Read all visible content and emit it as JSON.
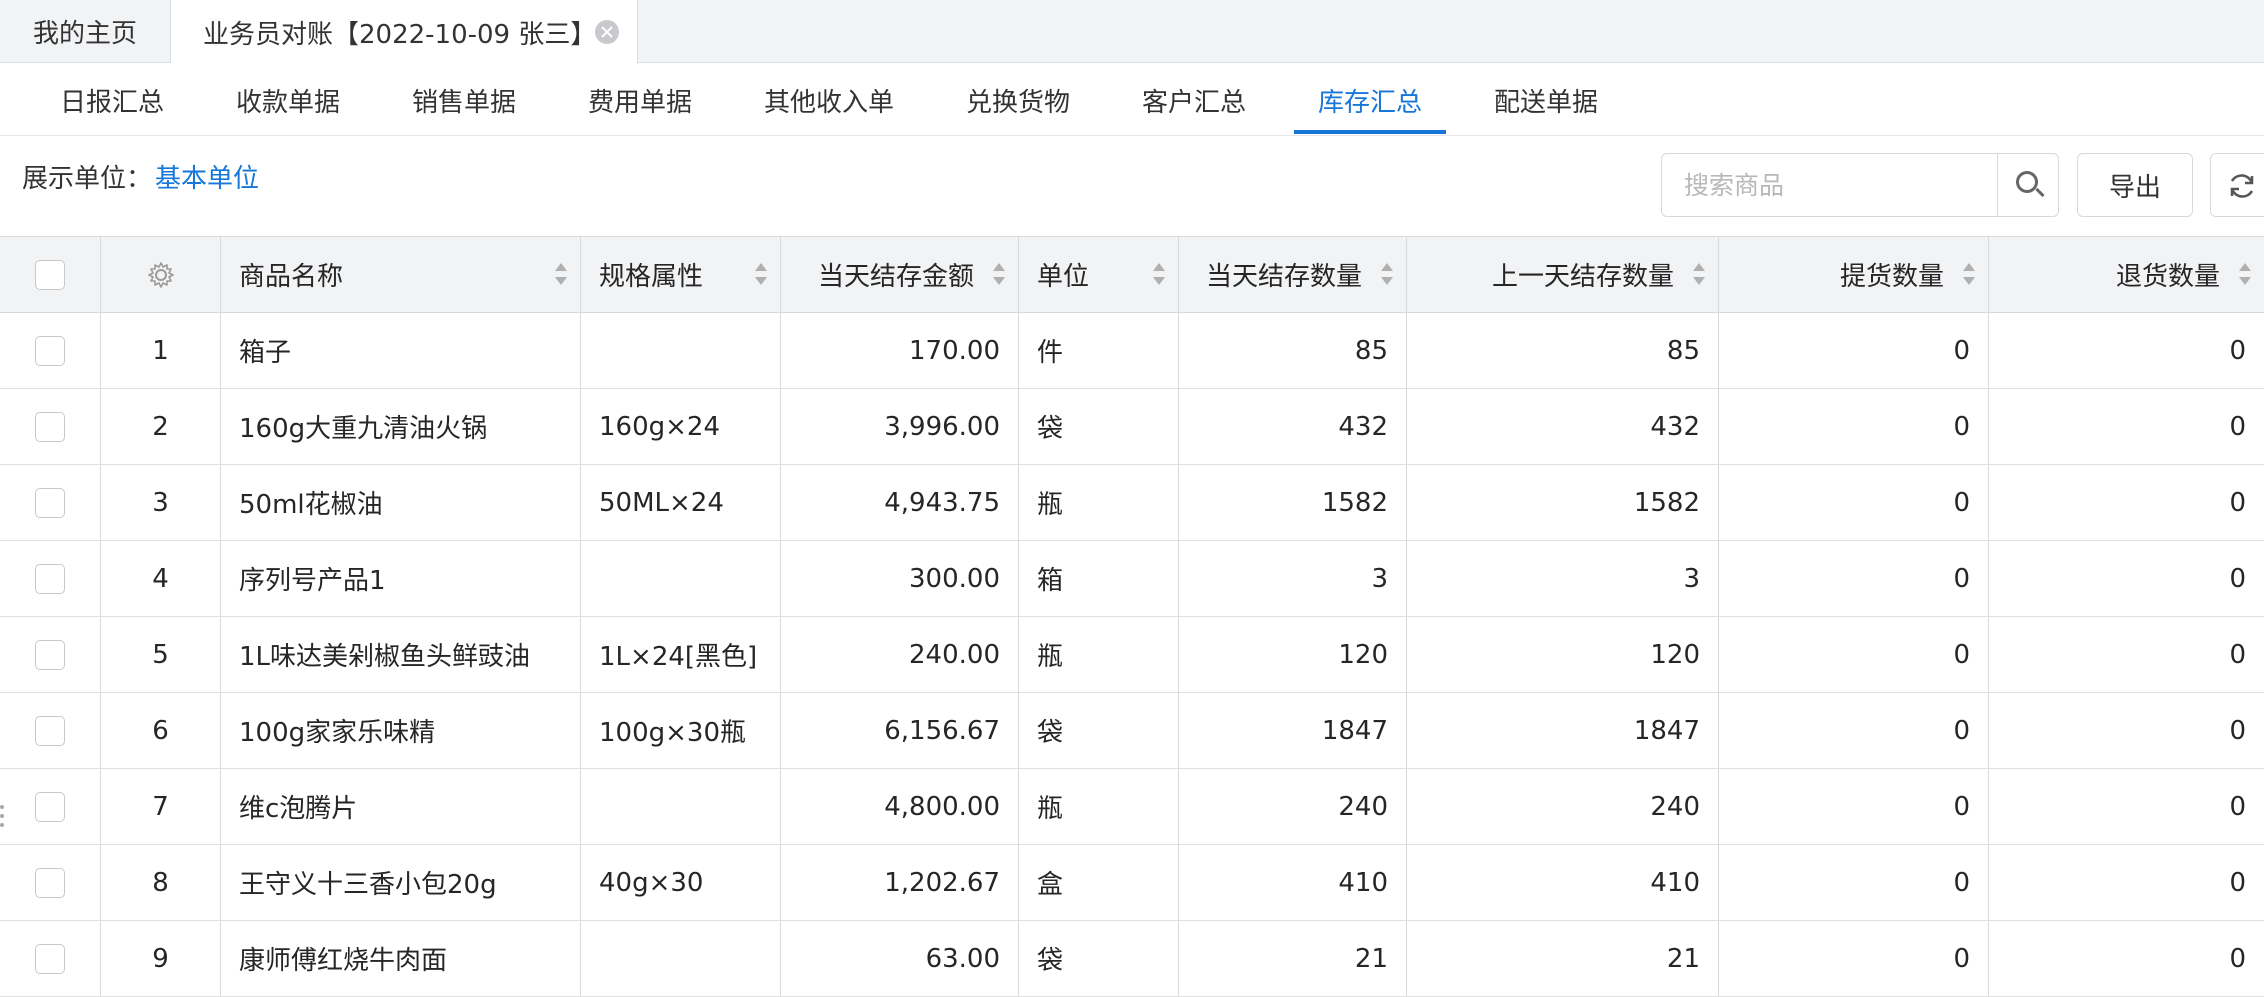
{
  "window_tabs": [
    {
      "label": "我的主页"
    },
    {
      "label": "业务员对账【2022-10-09 张三】"
    }
  ],
  "sub_tabs": [
    {
      "label": "日报汇总"
    },
    {
      "label": "收款单据"
    },
    {
      "label": "销售单据"
    },
    {
      "label": "费用单据"
    },
    {
      "label": "其他收入单"
    },
    {
      "label": "兑换货物"
    },
    {
      "label": "客户汇总"
    },
    {
      "label": "库存汇总",
      "active": true
    },
    {
      "label": "配送单据"
    }
  ],
  "toolbar": {
    "unit_label": "展示单位：",
    "unit_value": "基本单位",
    "search_placeholder": "搜索商品",
    "export_label": "导出"
  },
  "table": {
    "columns": [
      "商品名称",
      "规格属性",
      "当天结存金额",
      "单位",
      "当天结存数量",
      "上一天结存数量",
      "提货数量",
      "退货数量"
    ],
    "rows": [
      {
        "index": "1",
        "name": "箱子",
        "spec": "",
        "amount": "170.00",
        "unit": "件",
        "qty_today": "85",
        "qty_prev": "85",
        "pickup": "0",
        "returned": "0"
      },
      {
        "index": "2",
        "name": "160g大重九清油火锅",
        "spec": "160g×24",
        "amount": "3,996.00",
        "unit": "袋",
        "qty_today": "432",
        "qty_prev": "432",
        "pickup": "0",
        "returned": "0"
      },
      {
        "index": "3",
        "name": "50ml花椒油",
        "spec": "50ML×24",
        "amount": "4,943.75",
        "unit": "瓶",
        "qty_today": "1582",
        "qty_prev": "1582",
        "pickup": "0",
        "returned": "0"
      },
      {
        "index": "4",
        "name": "序列号产品1",
        "spec": "",
        "amount": "300.00",
        "unit": "箱",
        "qty_today": "3",
        "qty_prev": "3",
        "pickup": "0",
        "returned": "0"
      },
      {
        "index": "5",
        "name": "1L味达美剁椒鱼头鲜豉油",
        "spec": "1L×24[黑色]",
        "amount": "240.00",
        "unit": "瓶",
        "qty_today": "120",
        "qty_prev": "120",
        "pickup": "0",
        "returned": "0"
      },
      {
        "index": "6",
        "name": "100g家家乐味精",
        "spec": "100g×30瓶",
        "amount": "6,156.67",
        "unit": "袋",
        "qty_today": "1847",
        "qty_prev": "1847",
        "pickup": "0",
        "returned": "0"
      },
      {
        "index": "7",
        "name": "维c泡腾片",
        "spec": "",
        "amount": "4,800.00",
        "unit": "瓶",
        "qty_today": "240",
        "qty_prev": "240",
        "pickup": "0",
        "returned": "0"
      },
      {
        "index": "8",
        "name": "王守义十三香小包20g",
        "spec": "40g×30",
        "amount": "1,202.67",
        "unit": "盒",
        "qty_today": "410",
        "qty_prev": "410",
        "pickup": "0",
        "returned": "0"
      },
      {
        "index": "9",
        "name": "康师傅红烧牛肉面",
        "spec": "",
        "amount": "63.00",
        "unit": "袋",
        "qty_today": "21",
        "qty_prev": "21",
        "pickup": "0",
        "returned": "0"
      }
    ]
  },
  "colors": {
    "accent": "#1677d9",
    "header_bg": "#f2f3f5",
    "border": "#d9d9d9"
  },
  "icons": [
    "close-icon",
    "search-icon",
    "refresh-icon",
    "gear-icon",
    "sort-icon"
  ]
}
